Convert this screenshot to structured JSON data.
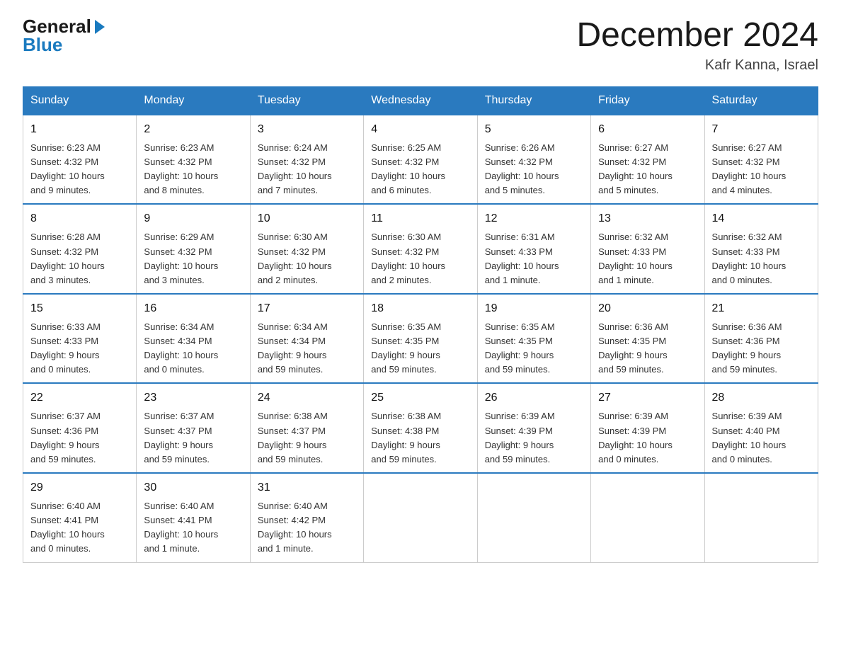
{
  "header": {
    "logo_general": "General",
    "logo_blue": "Blue",
    "month_title": "December 2024",
    "location": "Kafr Kanna, Israel"
  },
  "days_of_week": [
    "Sunday",
    "Monday",
    "Tuesday",
    "Wednesday",
    "Thursday",
    "Friday",
    "Saturday"
  ],
  "weeks": [
    [
      {
        "day": "1",
        "sunrise": "6:23 AM",
        "sunset": "4:32 PM",
        "daylight": "10 hours and 9 minutes."
      },
      {
        "day": "2",
        "sunrise": "6:23 AM",
        "sunset": "4:32 PM",
        "daylight": "10 hours and 8 minutes."
      },
      {
        "day": "3",
        "sunrise": "6:24 AM",
        "sunset": "4:32 PM",
        "daylight": "10 hours and 7 minutes."
      },
      {
        "day": "4",
        "sunrise": "6:25 AM",
        "sunset": "4:32 PM",
        "daylight": "10 hours and 6 minutes."
      },
      {
        "day": "5",
        "sunrise": "6:26 AM",
        "sunset": "4:32 PM",
        "daylight": "10 hours and 5 minutes."
      },
      {
        "day": "6",
        "sunrise": "6:27 AM",
        "sunset": "4:32 PM",
        "daylight": "10 hours and 5 minutes."
      },
      {
        "day": "7",
        "sunrise": "6:27 AM",
        "sunset": "4:32 PM",
        "daylight": "10 hours and 4 minutes."
      }
    ],
    [
      {
        "day": "8",
        "sunrise": "6:28 AM",
        "sunset": "4:32 PM",
        "daylight": "10 hours and 3 minutes."
      },
      {
        "day": "9",
        "sunrise": "6:29 AM",
        "sunset": "4:32 PM",
        "daylight": "10 hours and 3 minutes."
      },
      {
        "day": "10",
        "sunrise": "6:30 AM",
        "sunset": "4:32 PM",
        "daylight": "10 hours and 2 minutes."
      },
      {
        "day": "11",
        "sunrise": "6:30 AM",
        "sunset": "4:32 PM",
        "daylight": "10 hours and 2 minutes."
      },
      {
        "day": "12",
        "sunrise": "6:31 AM",
        "sunset": "4:33 PM",
        "daylight": "10 hours and 1 minute."
      },
      {
        "day": "13",
        "sunrise": "6:32 AM",
        "sunset": "4:33 PM",
        "daylight": "10 hours and 1 minute."
      },
      {
        "day": "14",
        "sunrise": "6:32 AM",
        "sunset": "4:33 PM",
        "daylight": "10 hours and 0 minutes."
      }
    ],
    [
      {
        "day": "15",
        "sunrise": "6:33 AM",
        "sunset": "4:33 PM",
        "daylight": "9 hours and 0 minutes."
      },
      {
        "day": "16",
        "sunrise": "6:34 AM",
        "sunset": "4:34 PM",
        "daylight": "10 hours and 0 minutes."
      },
      {
        "day": "17",
        "sunrise": "6:34 AM",
        "sunset": "4:34 PM",
        "daylight": "9 hours and 59 minutes."
      },
      {
        "day": "18",
        "sunrise": "6:35 AM",
        "sunset": "4:35 PM",
        "daylight": "9 hours and 59 minutes."
      },
      {
        "day": "19",
        "sunrise": "6:35 AM",
        "sunset": "4:35 PM",
        "daylight": "9 hours and 59 minutes."
      },
      {
        "day": "20",
        "sunrise": "6:36 AM",
        "sunset": "4:35 PM",
        "daylight": "9 hours and 59 minutes."
      },
      {
        "day": "21",
        "sunrise": "6:36 AM",
        "sunset": "4:36 PM",
        "daylight": "9 hours and 59 minutes."
      }
    ],
    [
      {
        "day": "22",
        "sunrise": "6:37 AM",
        "sunset": "4:36 PM",
        "daylight": "9 hours and 59 minutes."
      },
      {
        "day": "23",
        "sunrise": "6:37 AM",
        "sunset": "4:37 PM",
        "daylight": "9 hours and 59 minutes."
      },
      {
        "day": "24",
        "sunrise": "6:38 AM",
        "sunset": "4:37 PM",
        "daylight": "9 hours and 59 minutes."
      },
      {
        "day": "25",
        "sunrise": "6:38 AM",
        "sunset": "4:38 PM",
        "daylight": "9 hours and 59 minutes."
      },
      {
        "day": "26",
        "sunrise": "6:39 AM",
        "sunset": "4:39 PM",
        "daylight": "9 hours and 59 minutes."
      },
      {
        "day": "27",
        "sunrise": "6:39 AM",
        "sunset": "4:39 PM",
        "daylight": "10 hours and 0 minutes."
      },
      {
        "day": "28",
        "sunrise": "6:39 AM",
        "sunset": "4:40 PM",
        "daylight": "10 hours and 0 minutes."
      }
    ],
    [
      {
        "day": "29",
        "sunrise": "6:40 AM",
        "sunset": "4:41 PM",
        "daylight": "10 hours and 0 minutes."
      },
      {
        "day": "30",
        "sunrise": "6:40 AM",
        "sunset": "4:41 PM",
        "daylight": "10 hours and 1 minute."
      },
      {
        "day": "31",
        "sunrise": "6:40 AM",
        "sunset": "4:42 PM",
        "daylight": "10 hours and 1 minute."
      },
      null,
      null,
      null,
      null
    ]
  ],
  "labels": {
    "sunrise_prefix": "Sunrise: ",
    "sunset_prefix": "Sunset: ",
    "daylight_prefix": "Daylight: "
  }
}
